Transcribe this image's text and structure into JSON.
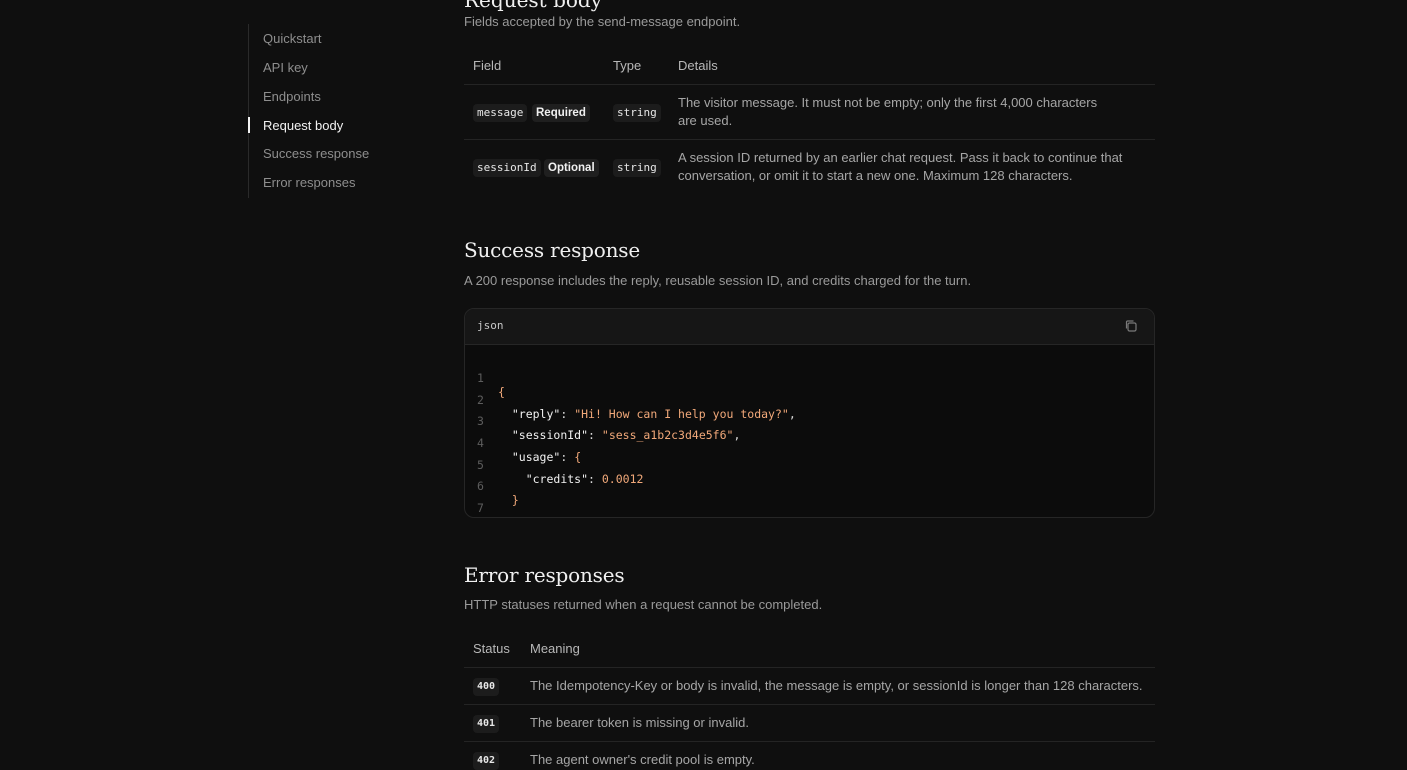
{
  "sidebar": {
    "items": [
      {
        "label": "Quickstart"
      },
      {
        "label": "API key"
      },
      {
        "label": "Endpoints"
      },
      {
        "label": "Request body",
        "active": true
      },
      {
        "label": "Success response"
      },
      {
        "label": "Error responses"
      }
    ]
  },
  "request_body": {
    "title": "Request body",
    "description": "Fields accepted by the send-message endpoint.",
    "headers": {
      "field": "Field",
      "type": "Type",
      "details": "Details"
    },
    "rows": [
      {
        "field": "message",
        "badge": "Required",
        "type": "string",
        "details": "The visitor message. It must not be empty; only the first 4,000 characters are used."
      },
      {
        "field": "sessionId",
        "badge": "Optional",
        "type": "string",
        "details": "A session ID returned by an earlier chat request. Pass it back to continue that conversation, or omit it to start a new one. Maximum 128 characters."
      }
    ]
  },
  "success_response": {
    "title": "Success response",
    "description": "A 200 response includes the reply, reusable session ID, and credits charged for the turn.",
    "code_language": "json",
    "copy_icon": "copy-icon",
    "code_lines": [
      {
        "num": "1",
        "text": "{"
      },
      {
        "num": "2",
        "key": "\"reply\"",
        "value": "\"Hi! How can I help you today?\"",
        "trail": ","
      },
      {
        "num": "3",
        "key": "\"sessionId\"",
        "value": "\"sess_a1b2c3d4e5f6\"",
        "trail": ","
      },
      {
        "num": "4",
        "key": "\"usage\"",
        "value": "{",
        "trail": ""
      },
      {
        "num": "5",
        "key": "\"credits\"",
        "value": "0.0012",
        "trail": ""
      },
      {
        "num": "6",
        "text": "}"
      },
      {
        "num": "7",
        "text": "}"
      }
    ]
  },
  "error_responses": {
    "title": "Error responses",
    "description": "HTTP statuses returned when a request cannot be completed.",
    "headers": {
      "status": "Status",
      "meaning": "Meaning"
    },
    "rows": [
      {
        "status": "400",
        "meaning": "The Idempotency-Key or body is invalid, the message is empty, or sessionId is longer than 128 characters."
      },
      {
        "status": "401",
        "meaning": "The bearer token is missing or invalid."
      },
      {
        "status": "402",
        "meaning": "The agent owner's credit pool is empty."
      }
    ]
  }
}
